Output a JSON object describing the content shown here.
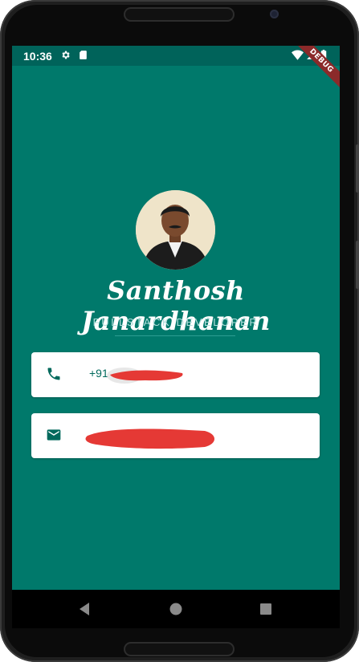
{
  "status_bar": {
    "time": "10:36",
    "icons": [
      "settings-icon",
      "sd-card-icon",
      "wifi-icon",
      "signal-icon",
      "battery-icon"
    ],
    "debug_banner": "DEBUG"
  },
  "profile": {
    "name": "Santhosh Janardhanan",
    "title": "FULLSTACK DEVELOPER",
    "avatar_icon": "profile-photo"
  },
  "contacts": {
    "phone": {
      "icon": "phone-icon",
      "visible_prefix": "+91"
    },
    "email": {
      "icon": "email-icon",
      "visible_prefix": ""
    }
  },
  "nav_bar": {
    "buttons": [
      "back-icon",
      "home-icon",
      "recents-icon"
    ]
  },
  "colors": {
    "background": "#00796b",
    "status_bar": "#00635a",
    "card": "#ffffff",
    "card_text": "#00695c",
    "subtitle": "#b2dfdb",
    "redaction": "#e53935"
  }
}
